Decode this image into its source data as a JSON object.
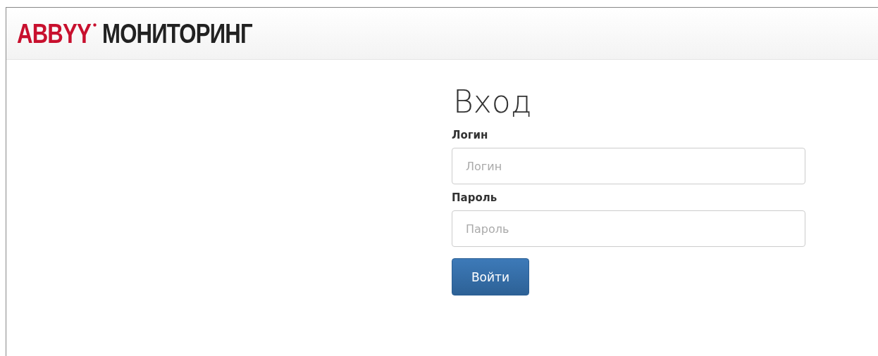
{
  "header": {
    "logo_brand": "ABBYY",
    "logo_product": "МОНИТОРИНГ"
  },
  "form": {
    "title": "Вход",
    "fields": [
      {
        "label": "Логин",
        "placeholder": "Логин"
      },
      {
        "label": "Пароль",
        "placeholder": "Пароль"
      }
    ],
    "submit": "Войти"
  }
}
